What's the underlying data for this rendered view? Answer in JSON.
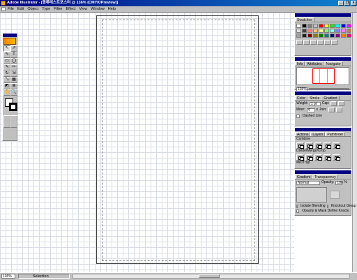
{
  "window": {
    "title": "Adobe Illustrator - [종류테스트포스터 @ 136% (CMYK/Preview)]",
    "minimize": "_",
    "restore": "❐",
    "close": "×"
  },
  "menu": [
    "File",
    "Edit",
    "Object",
    "Type",
    "Filter",
    "Effect",
    "View",
    "Window",
    "Help"
  ],
  "status": {
    "zoom": "136%",
    "mode": "Selection"
  },
  "panels": {
    "swatches": {
      "tabs": [
        "Swatches"
      ],
      "colors": [
        "#ffffff",
        "#000000",
        "#808080",
        "#c0c0c0",
        "#ff0000",
        "#ffff00",
        "#00ff00",
        "#00ffff",
        "#0000ff",
        "#ff00ff",
        "#e0e0e0",
        "#404040",
        "#ff8080",
        "#ffc080",
        "#ffff80",
        "#80ff80",
        "#80ffff",
        "#8080ff",
        "#ff80ff",
        "#c08040",
        "#a0a0a0",
        "#202020",
        "#800000",
        "#808000",
        "#008000",
        "#008080",
        "#000080",
        "#800080",
        "#ff8000",
        "#ff0080"
      ]
    },
    "navigator": {
      "tabs": [
        "Info",
        "Attributes",
        "Navigator"
      ],
      "zoom": "136%"
    },
    "stroke": {
      "tabs": [
        "Color",
        "Stroke",
        "Gradient"
      ],
      "weight_label": "Weight:",
      "weight_value": "1 pt",
      "miter_label": "Miter:",
      "miter_value": "4",
      "miter_unit": "x",
      "cap_label": "Cap:",
      "join_label": "Join:",
      "dashed_label": "Dashed Line"
    },
    "pathfinder": {
      "tabs": [
        "Actions",
        "Layers",
        "Pathfinder"
      ],
      "combine": "Combine",
      "divide": "Divide/Merge/Crop",
      "mix": "Mix/Trap"
    },
    "transparency": {
      "tabs": [
        "Gradient",
        "Transparency"
      ],
      "blend_mode": "Normal",
      "opacity_label": "Opacity:",
      "opacity_value": "100",
      "opacity_unit": "%",
      "isolate": "Isolate Blending",
      "knockout": "Knockout Group",
      "opacity_mask": "Opacity & Mask Define Knockout Shape"
    }
  },
  "toolbox": {
    "tools": [
      "↖",
      "↗",
      "✎",
      "T",
      "▭",
      "◯",
      "✎",
      "✂",
      "↻",
      "⇲",
      "⤡",
      "▦",
      "◩",
      "⊞",
      "✋",
      "🔍"
    ]
  }
}
